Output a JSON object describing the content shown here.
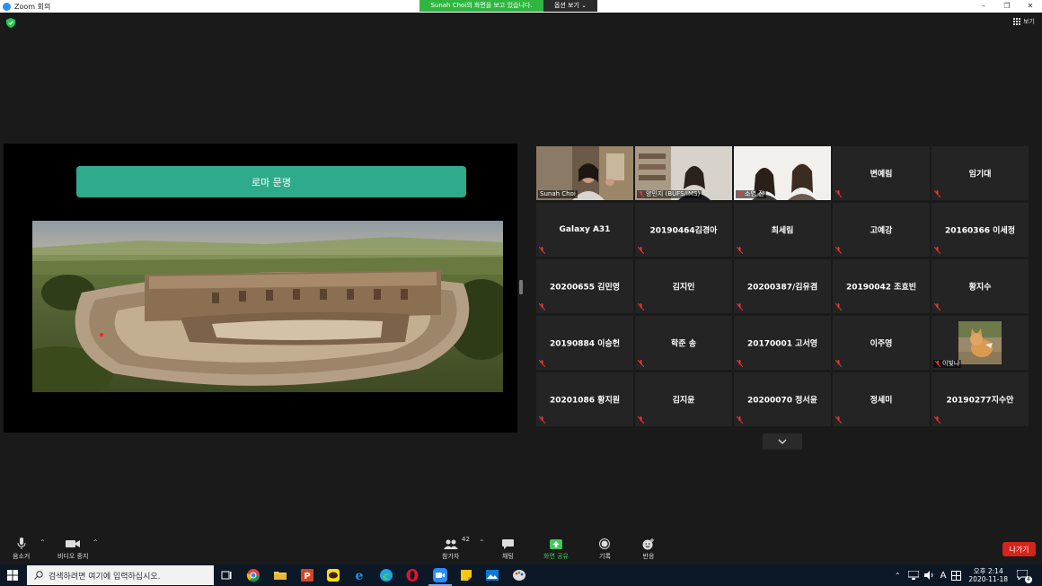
{
  "window": {
    "title": "Zoom 회의",
    "minimize": "–",
    "restore": "❐",
    "close": "✕"
  },
  "share_banner": {
    "text": "Sunah Choi의 화면을 보고 있습니다.",
    "options_label": "옵션 보기 ⌄"
  },
  "view_button": {
    "label": "보기"
  },
  "shared_screen": {
    "slide_title": "로마 문명"
  },
  "gallery": {
    "video_tiles": [
      {
        "name": "Sunah Choi"
      },
      {
        "name": "양민지 (BUFS/IMS)"
      },
      {
        "name": "소영 진"
      }
    ],
    "name_tiles": [
      "변예림",
      "임기대",
      "Galaxy A31",
      "20190464김경아",
      "최세림",
      "고예강",
      "20160366 이세정",
      "20200655 김민영",
      "김지인",
      "20200387/김유겸",
      "20190042 조효빈",
      "황지수",
      "20190884 이승헌",
      "학준 송",
      "20170001 고서영",
      "이주영",
      "20201086 황지원",
      "김지윤",
      "20200070 정서윤",
      "정세미",
      "20190277지수안"
    ],
    "photo_tile": {
      "name": "이빛나"
    }
  },
  "toolbar": {
    "audio_label": "음소거",
    "video_label": "비디오 중지",
    "participants_label": "참가자",
    "participants_count": "42",
    "chat_label": "채팅",
    "share_label": "화면 공유",
    "record_label": "기록",
    "reactions_label": "반응",
    "leave_label": "나가기"
  },
  "taskbar": {
    "search_placeholder": "검색하려면 여기에 입력하십시오.",
    "ime": "A",
    "time": "오후 2:14",
    "date": "2020-11-18",
    "notification_count": "4"
  },
  "colors": {
    "accent_green": "#30b640",
    "slide_green": "#2eab8a",
    "leave_red": "#d6231c",
    "active_speaker": "#e8d84a"
  }
}
